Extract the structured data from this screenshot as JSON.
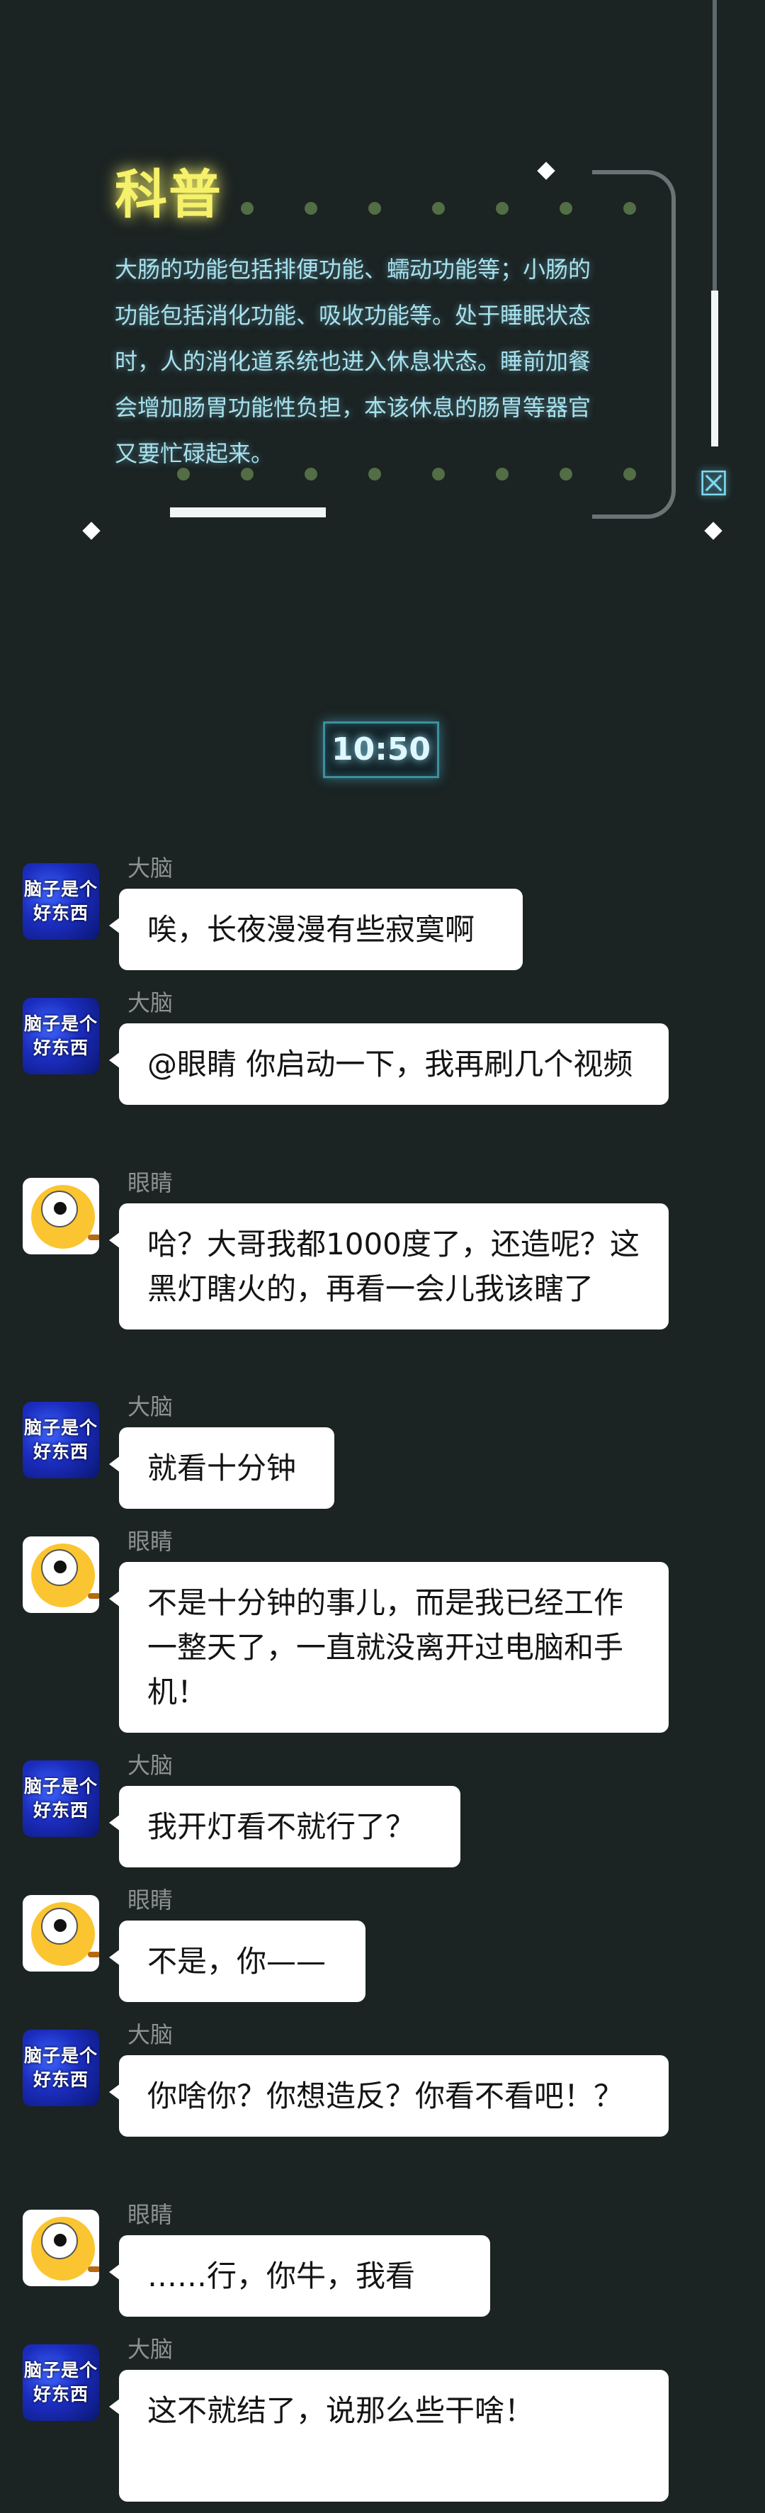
{
  "science_card": {
    "title": "科普",
    "body": "大肠的功能包括排便功能、蠕动功能等；小肠的\n功能包括消化功能、吸收功能等。处于睡眠状态\n时，人的消化道系统也进入休息状态。睡前加餐\n会增加肠胃功能性负担，本该休息的肠胃等器官\n又要忙碌起来。"
  },
  "time_badge": "10:50",
  "avatars": {
    "brain_text": "脑子是个\n好东西"
  },
  "messages": [
    {
      "sender": "大脑",
      "text": "唉，长夜漫漫有些寂寞啊"
    },
    {
      "sender": "大脑",
      "text": "@眼睛 你启动一下，我再刷几个视频"
    },
    {
      "sender": "眼睛",
      "text": "哈？大哥我都1000度了，还造呢？这黑灯瞎火的，再看一会儿我该瞎了"
    },
    {
      "sender": "大脑",
      "text": "就看十分钟"
    },
    {
      "sender": "眼睛",
      "text": "不是十分钟的事儿，而是我已经工作一整天了，一直就没离开过电脑和手机！"
    },
    {
      "sender": "大脑",
      "text": "我开灯看不就行了？"
    },
    {
      "sender": "眼睛",
      "text": "不是，你——"
    },
    {
      "sender": "大脑",
      "text": "你啥你？你想造反？你看不看吧！？"
    },
    {
      "sender": "眼睛",
      "text": "……行，你牛，我看"
    },
    {
      "sender": "大脑",
      "text": "这不就结了，说那么些干啥！"
    }
  ],
  "icons": {
    "corner_icon": "box-x-icon"
  }
}
